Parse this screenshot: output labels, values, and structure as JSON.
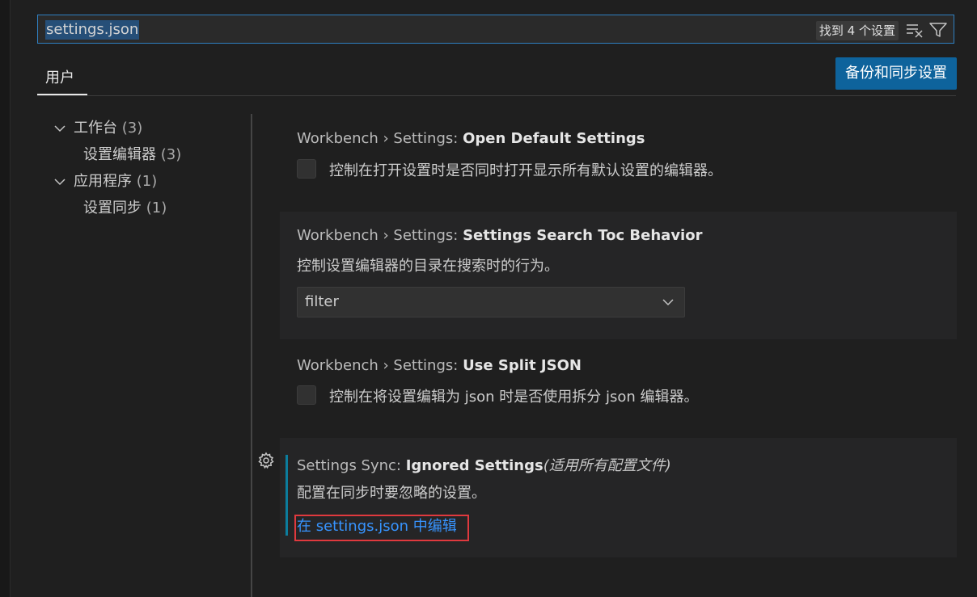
{
  "search": {
    "value": "settings.json",
    "results_badge": "找到 4 个设置",
    "clear_icon": "clear-filter-icon",
    "filter_icon": "filter-icon"
  },
  "tabs": [
    {
      "label": "用户",
      "active": true
    }
  ],
  "sync_button": {
    "label": "备份和同步设置",
    "color": "#0e639c"
  },
  "toc": [
    {
      "label": "工作台",
      "count": "(3)",
      "level": 1,
      "expanded": true
    },
    {
      "label": "设置编辑器",
      "count": "(3)",
      "level": 2
    },
    {
      "label": "应用程序",
      "count": "(1)",
      "level": 1,
      "expanded": true
    },
    {
      "label": "设置同步",
      "count": "(1)",
      "level": 2
    }
  ],
  "settings": [
    {
      "category": "Workbench › Settings: ",
      "name": "Open Default Settings",
      "control": "checkbox",
      "checked": false,
      "description": "控制在打开设置时是否同时打开显示所有默认设置的编辑器。"
    },
    {
      "category": "Workbench › Settings: ",
      "name": "Settings Search Toc Behavior",
      "control": "select",
      "description": "控制设置编辑器的目录在搜索时的行为。",
      "selected_value": "filter"
    },
    {
      "category": "Workbench › Settings: ",
      "name": "Use Split JSON",
      "control": "checkbox",
      "checked": false,
      "description": "控制在将设置编辑为 json 时是否使用拆分 json 编辑器。"
    },
    {
      "category": "Settings Sync: ",
      "name": "Ignored Settings",
      "scope": "(适用所有配置文件)",
      "control": "link",
      "description": "配置在同步时要忽略的设置。",
      "link_label": "在 settings.json 中编辑",
      "modified": true
    }
  ],
  "colors": {
    "accent": "#2f7fc1",
    "link": "#3794ff",
    "modified_indicator": "#0c7d9d",
    "highlight_annotation": "#e0393e"
  }
}
